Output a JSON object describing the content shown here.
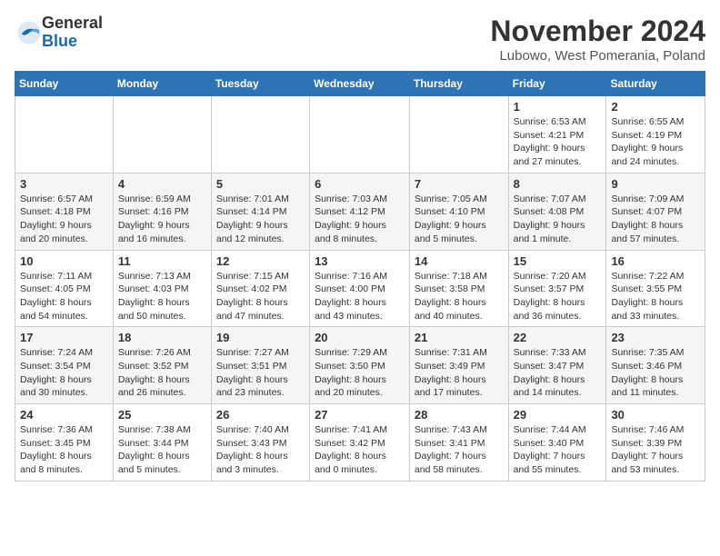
{
  "logo": {
    "general": "General",
    "blue": "Blue"
  },
  "title": "November 2024",
  "location": "Lubowo, West Pomerania, Poland",
  "headers": [
    "Sunday",
    "Monday",
    "Tuesday",
    "Wednesday",
    "Thursday",
    "Friday",
    "Saturday"
  ],
  "weeks": [
    [
      {
        "day": "",
        "info": ""
      },
      {
        "day": "",
        "info": ""
      },
      {
        "day": "",
        "info": ""
      },
      {
        "day": "",
        "info": ""
      },
      {
        "day": "",
        "info": ""
      },
      {
        "day": "1",
        "info": "Sunrise: 6:53 AM\nSunset: 4:21 PM\nDaylight: 9 hours and 27 minutes."
      },
      {
        "day": "2",
        "info": "Sunrise: 6:55 AM\nSunset: 4:19 PM\nDaylight: 9 hours and 24 minutes."
      }
    ],
    [
      {
        "day": "3",
        "info": "Sunrise: 6:57 AM\nSunset: 4:18 PM\nDaylight: 9 hours and 20 minutes."
      },
      {
        "day": "4",
        "info": "Sunrise: 6:59 AM\nSunset: 4:16 PM\nDaylight: 9 hours and 16 minutes."
      },
      {
        "day": "5",
        "info": "Sunrise: 7:01 AM\nSunset: 4:14 PM\nDaylight: 9 hours and 12 minutes."
      },
      {
        "day": "6",
        "info": "Sunrise: 7:03 AM\nSunset: 4:12 PM\nDaylight: 9 hours and 8 minutes."
      },
      {
        "day": "7",
        "info": "Sunrise: 7:05 AM\nSunset: 4:10 PM\nDaylight: 9 hours and 5 minutes."
      },
      {
        "day": "8",
        "info": "Sunrise: 7:07 AM\nSunset: 4:08 PM\nDaylight: 9 hours and 1 minute."
      },
      {
        "day": "9",
        "info": "Sunrise: 7:09 AM\nSunset: 4:07 PM\nDaylight: 8 hours and 57 minutes."
      }
    ],
    [
      {
        "day": "10",
        "info": "Sunrise: 7:11 AM\nSunset: 4:05 PM\nDaylight: 8 hours and 54 minutes."
      },
      {
        "day": "11",
        "info": "Sunrise: 7:13 AM\nSunset: 4:03 PM\nDaylight: 8 hours and 50 minutes."
      },
      {
        "day": "12",
        "info": "Sunrise: 7:15 AM\nSunset: 4:02 PM\nDaylight: 8 hours and 47 minutes."
      },
      {
        "day": "13",
        "info": "Sunrise: 7:16 AM\nSunset: 4:00 PM\nDaylight: 8 hours and 43 minutes."
      },
      {
        "day": "14",
        "info": "Sunrise: 7:18 AM\nSunset: 3:58 PM\nDaylight: 8 hours and 40 minutes."
      },
      {
        "day": "15",
        "info": "Sunrise: 7:20 AM\nSunset: 3:57 PM\nDaylight: 8 hours and 36 minutes."
      },
      {
        "day": "16",
        "info": "Sunrise: 7:22 AM\nSunset: 3:55 PM\nDaylight: 8 hours and 33 minutes."
      }
    ],
    [
      {
        "day": "17",
        "info": "Sunrise: 7:24 AM\nSunset: 3:54 PM\nDaylight: 8 hours and 30 minutes."
      },
      {
        "day": "18",
        "info": "Sunrise: 7:26 AM\nSunset: 3:52 PM\nDaylight: 8 hours and 26 minutes."
      },
      {
        "day": "19",
        "info": "Sunrise: 7:27 AM\nSunset: 3:51 PM\nDaylight: 8 hours and 23 minutes."
      },
      {
        "day": "20",
        "info": "Sunrise: 7:29 AM\nSunset: 3:50 PM\nDaylight: 8 hours and 20 minutes."
      },
      {
        "day": "21",
        "info": "Sunrise: 7:31 AM\nSunset: 3:49 PM\nDaylight: 8 hours and 17 minutes."
      },
      {
        "day": "22",
        "info": "Sunrise: 7:33 AM\nSunset: 3:47 PM\nDaylight: 8 hours and 14 minutes."
      },
      {
        "day": "23",
        "info": "Sunrise: 7:35 AM\nSunset: 3:46 PM\nDaylight: 8 hours and 11 minutes."
      }
    ],
    [
      {
        "day": "24",
        "info": "Sunrise: 7:36 AM\nSunset: 3:45 PM\nDaylight: 8 hours and 8 minutes."
      },
      {
        "day": "25",
        "info": "Sunrise: 7:38 AM\nSunset: 3:44 PM\nDaylight: 8 hours and 5 minutes."
      },
      {
        "day": "26",
        "info": "Sunrise: 7:40 AM\nSunset: 3:43 PM\nDaylight: 8 hours and 3 minutes."
      },
      {
        "day": "27",
        "info": "Sunrise: 7:41 AM\nSunset: 3:42 PM\nDaylight: 8 hours and 0 minutes."
      },
      {
        "day": "28",
        "info": "Sunrise: 7:43 AM\nSunset: 3:41 PM\nDaylight: 7 hours and 58 minutes."
      },
      {
        "day": "29",
        "info": "Sunrise: 7:44 AM\nSunset: 3:40 PM\nDaylight: 7 hours and 55 minutes."
      },
      {
        "day": "30",
        "info": "Sunrise: 7:46 AM\nSunset: 3:39 PM\nDaylight: 7 hours and 53 minutes."
      }
    ]
  ]
}
